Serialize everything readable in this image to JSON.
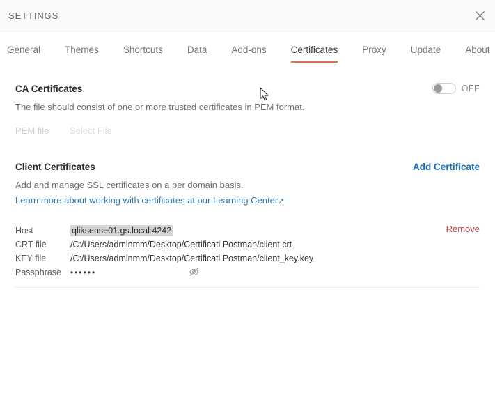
{
  "window": {
    "title": "SETTINGS",
    "close_icon": "close-icon"
  },
  "tabs": [
    {
      "label": "General",
      "active": false
    },
    {
      "label": "Themes",
      "active": false
    },
    {
      "label": "Shortcuts",
      "active": false
    },
    {
      "label": "Data",
      "active": false
    },
    {
      "label": "Add-ons",
      "active": false
    },
    {
      "label": "Certificates",
      "active": true
    },
    {
      "label": "Proxy",
      "active": false
    },
    {
      "label": "Update",
      "active": false
    },
    {
      "label": "About",
      "active": false
    }
  ],
  "ca_certificates": {
    "title": "CA Certificates",
    "description": "The file should consist of one or more trusted certificates in PEM format.",
    "toggle_state": "OFF",
    "pem_label": "PEM file",
    "select_file_label": "Select File"
  },
  "client_certificates": {
    "title": "Client Certificates",
    "add_label": "Add Certificate",
    "description": "Add and manage SSL certificates on a per domain basis.",
    "learn_more": "Learn more about working with certificates at our Learning Center",
    "learn_more_arrow": "↗",
    "entry": {
      "host_label": "Host",
      "host_value": "qliksense01.gs.local:4242",
      "crt_label": "CRT file",
      "crt_value": "/C:/Users/adminmm/Desktop/Certificati Postman/client.crt",
      "key_label": "KEY file",
      "key_value": "/C:/Users/adminmm/Desktop/Certificati Postman/client_key.key",
      "passphrase_label": "Passphrase",
      "passphrase_value": "••••••",
      "remove_label": "Remove",
      "eye_icon": "eye-off-icon"
    }
  },
  "colors": {
    "accent": "#e2714a",
    "link": "#1a73c8",
    "danger": "#c93c3c",
    "header_bg": "#fafafa"
  }
}
